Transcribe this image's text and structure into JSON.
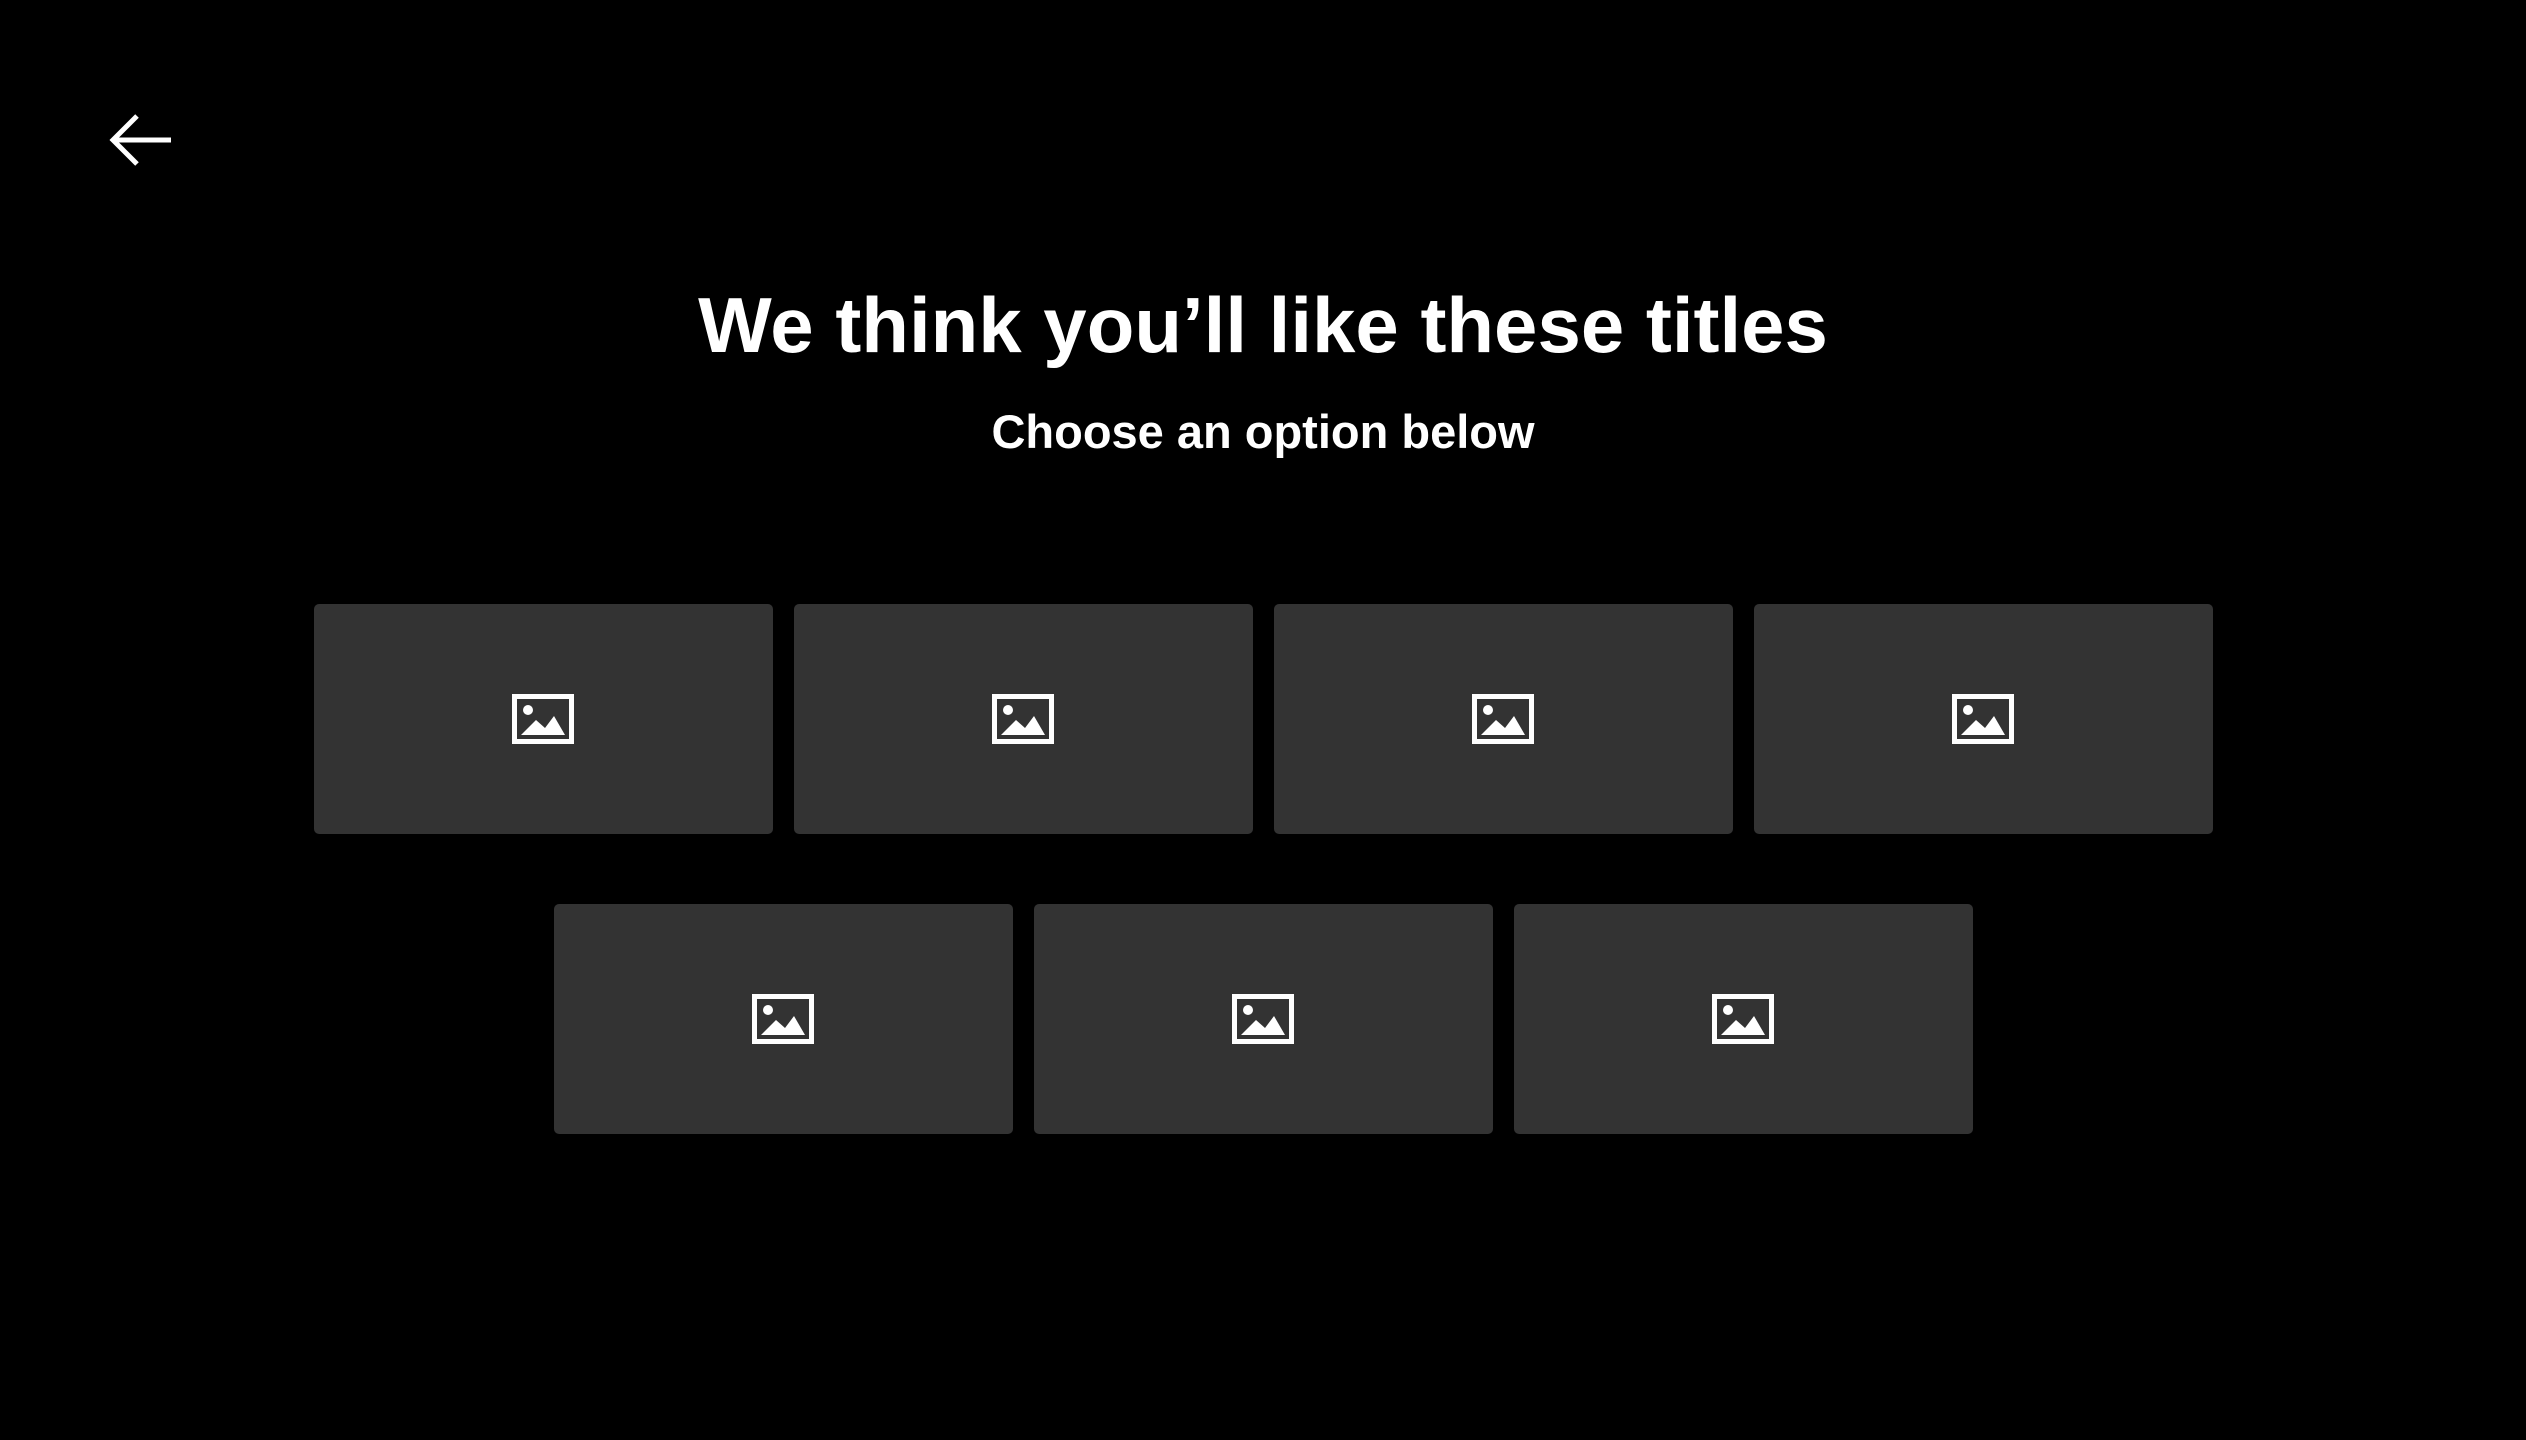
{
  "back": {
    "icon": "arrow-left-icon"
  },
  "heading": "We think you’ll like these titles",
  "subheading": "Choose an option below",
  "colors": {
    "background": "#000000",
    "tile": "#333333",
    "text": "#ffffff"
  },
  "titles": {
    "row1": [
      {
        "icon": "image-placeholder-icon"
      },
      {
        "icon": "image-placeholder-icon"
      },
      {
        "icon": "image-placeholder-icon"
      },
      {
        "icon": "image-placeholder-icon"
      }
    ],
    "row2": [
      {
        "icon": "image-placeholder-icon"
      },
      {
        "icon": "image-placeholder-icon"
      },
      {
        "icon": "image-placeholder-icon"
      }
    ]
  }
}
